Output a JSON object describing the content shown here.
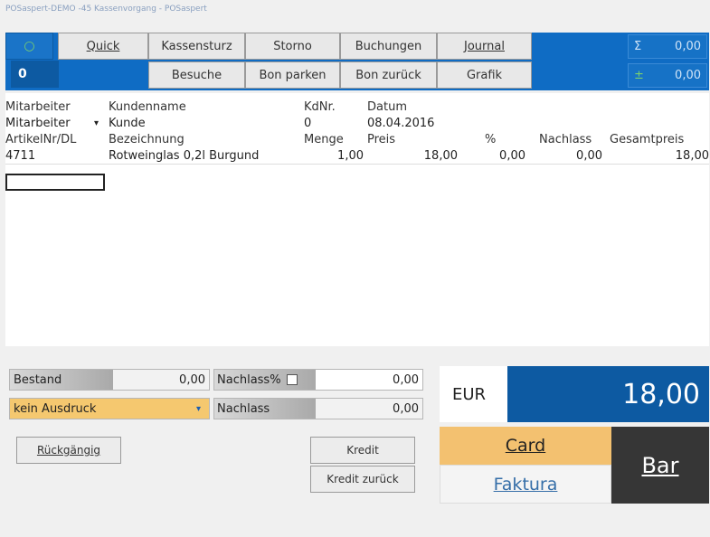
{
  "window_title": "POSaspert-DEMO -45 Kassenvorgang - POSaspert",
  "toolbar": {
    "add_icon_label": "○",
    "counter": "0",
    "buttons_row1": [
      "Quick",
      "Kassensturz",
      "Storno",
      "Buchungen",
      "Journal"
    ],
    "buttons_row2": [
      "Besuche",
      "Bon parken",
      "Bon zurück",
      "Grafik"
    ],
    "sum1_symbol": "Σ",
    "sum1_value": "0,00",
    "sum2_symbol": "±",
    "sum2_value": "0,00"
  },
  "customer": {
    "headers": [
      "Mitarbeiter",
      "Kundenname",
      "KdNr.",
      "Datum"
    ],
    "mitarbeiter": "Mitarbeiter",
    "kunde": "Kunde",
    "kdnr": "0",
    "datum": "08.04.2016"
  },
  "items": {
    "headers": [
      "ArtikelNr/DL",
      "Bezeichnung",
      "Menge",
      "Preis",
      "%",
      "Nachlass",
      "Gesamtpreis"
    ],
    "rows": [
      {
        "artikel": "4711",
        "bezeichnung": "Rotweinglas 0,2l Burgund",
        "menge": "1,00",
        "preis": "18,00",
        "prozent": "0,00",
        "nachlass": "0,00",
        "gesamt": "18,00"
      }
    ]
  },
  "bottom": {
    "bestand_label": "Bestand",
    "bestand_value": "0,00",
    "nachlass_pct_label": "Nachlass%",
    "nachlass_pct_value": "0,00",
    "druck_select": "kein Ausdruck",
    "nachlass_label": "Nachlass",
    "nachlass_value": "0,00",
    "rueckgaengig": "Rückgängig",
    "kredit": "Kredit",
    "kredit_zurueck": "Kredit zurück"
  },
  "payment": {
    "currency": "EUR",
    "total": "18,00",
    "card": "Card",
    "faktura": "Faktura",
    "bar": "Bar"
  },
  "colors": {
    "toolbar_blue": "#0f6cc4",
    "total_blue": "#0d5aa2",
    "card_orange": "#f3c170",
    "bar_dark": "#363636",
    "select_orange": "#f5c86f"
  }
}
